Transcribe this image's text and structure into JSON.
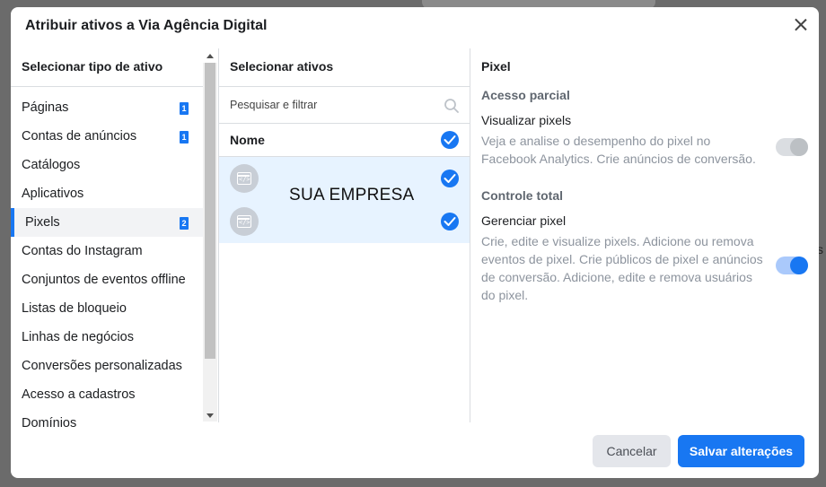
{
  "dialog": {
    "title": "Atribuir ativos a Via Agência Digital"
  },
  "asset_types": {
    "heading": "Selecionar tipo de ativo",
    "items": [
      {
        "label": "Páginas",
        "badge": "1"
      },
      {
        "label": "Contas de anúncios",
        "badge": "1"
      },
      {
        "label": "Catálogos"
      },
      {
        "label": "Aplicativos"
      },
      {
        "label": "Pixels",
        "badge": "2"
      },
      {
        "label": "Contas do Instagram"
      },
      {
        "label": "Conjuntos de eventos offline"
      },
      {
        "label": "Listas de bloqueio"
      },
      {
        "label": "Linhas de negócios"
      },
      {
        "label": "Conversões personalizadas"
      },
      {
        "label": "Acesso a cadastros"
      },
      {
        "label": "Domínios"
      }
    ]
  },
  "assets": {
    "heading": "Selecionar ativos",
    "search_placeholder": "Pesquisar e filtrar",
    "column_name": "Nome",
    "overlay_text": "SUA EMPRESA"
  },
  "permissions": {
    "heading": "Pixel",
    "partial": {
      "title": "Acesso parcial",
      "permission": "Visualizar pixels",
      "description": "Veja e analise o desempenho do pixel no Facebook Analytics. Crie anúncios de conversão.",
      "enabled": false
    },
    "full": {
      "title": "Controle total",
      "permission": "Gerenciar pixel",
      "description": "Crie, edite e visualize pixels. Adicione ou remova eventos de pixel. Crie públicos de pixel e anúncios de conversão. Adicione, edite e remova usuários do pixel.",
      "enabled": true
    }
  },
  "footer": {
    "cancel_label": "Cancelar",
    "save_label": "Salvar alterações"
  },
  "colors": {
    "accent": "#1877f2",
    "selected_row": "#e7f3ff"
  },
  "background_fragment": "s"
}
